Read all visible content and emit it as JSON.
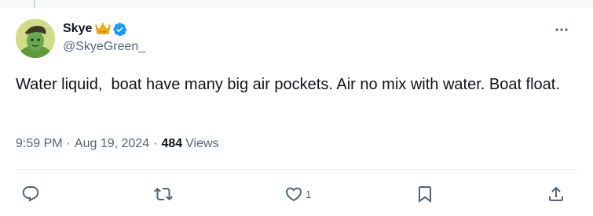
{
  "author": {
    "display_name": "Skye",
    "handle": "@SkyeGreen_",
    "badges": [
      "crown-emoji",
      "verified-badge"
    ]
  },
  "tweet": {
    "text": "Water liquid,  boat have many big air pockets. Air no mix with water. Boat float.",
    "time": "9:59 PM",
    "separator": "·",
    "date": "Aug 19, 2024",
    "views_count": "484",
    "views_label": "Views"
  },
  "actions": {
    "reply_icon": "reply-icon",
    "retweet_icon": "retweet-icon",
    "like_icon": "heart-icon",
    "like_count": "1",
    "bookmark_icon": "bookmark-icon",
    "share_icon": "share-icon"
  },
  "colors": {
    "text_primary": "#0f1419",
    "text_secondary": "#536471",
    "verified_blue": "#1d9bf0",
    "crown_gold": "#f4b400"
  }
}
